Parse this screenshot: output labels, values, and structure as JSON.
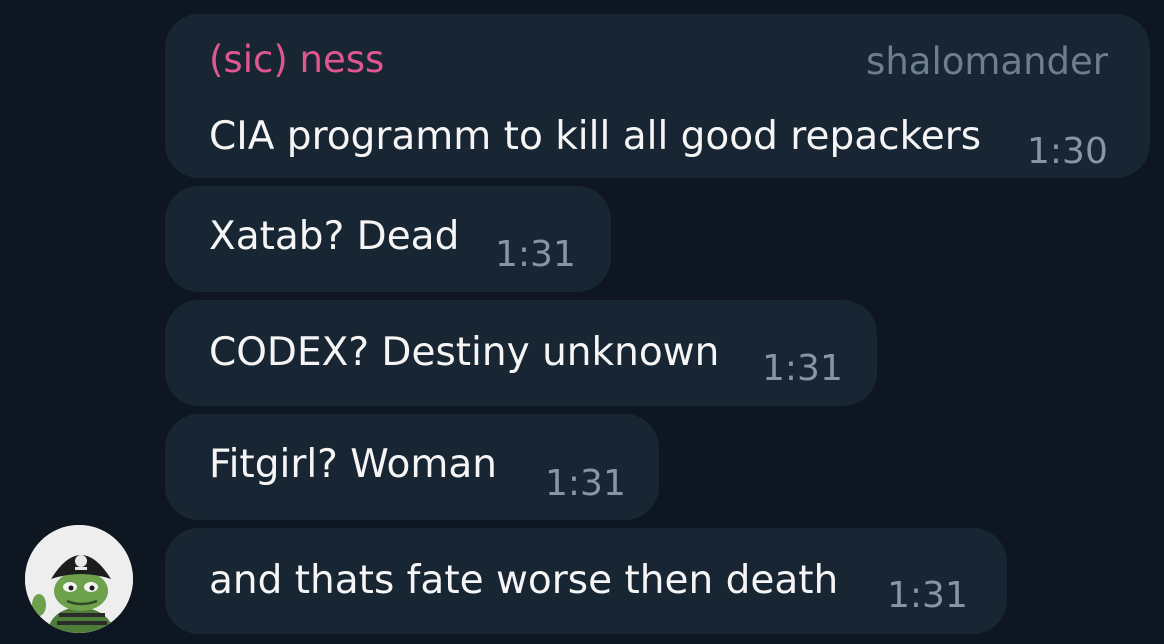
{
  "messages": [
    {
      "sender": "(sic) ness",
      "username": "shalomander",
      "text": "CIA programm to kill all good repackers",
      "time": "1:30"
    },
    {
      "text": "Xatab? Dead",
      "time": "1:31"
    },
    {
      "text": "CODEX? Destiny unknown",
      "time": "1:31"
    },
    {
      "text": "Fitgirl? Woman",
      "time": "1:31"
    },
    {
      "text": "and thats fate worse then death",
      "time": "1:31"
    }
  ],
  "colors": {
    "background": "#0e1621",
    "bubble": "#182533",
    "sender_name": "#e0578f",
    "username": "#6d7f8f",
    "message_text": "#f5f5f5",
    "timestamp": "#8696a6"
  },
  "avatar": {
    "icon": "pepe-pirate-avatar"
  }
}
